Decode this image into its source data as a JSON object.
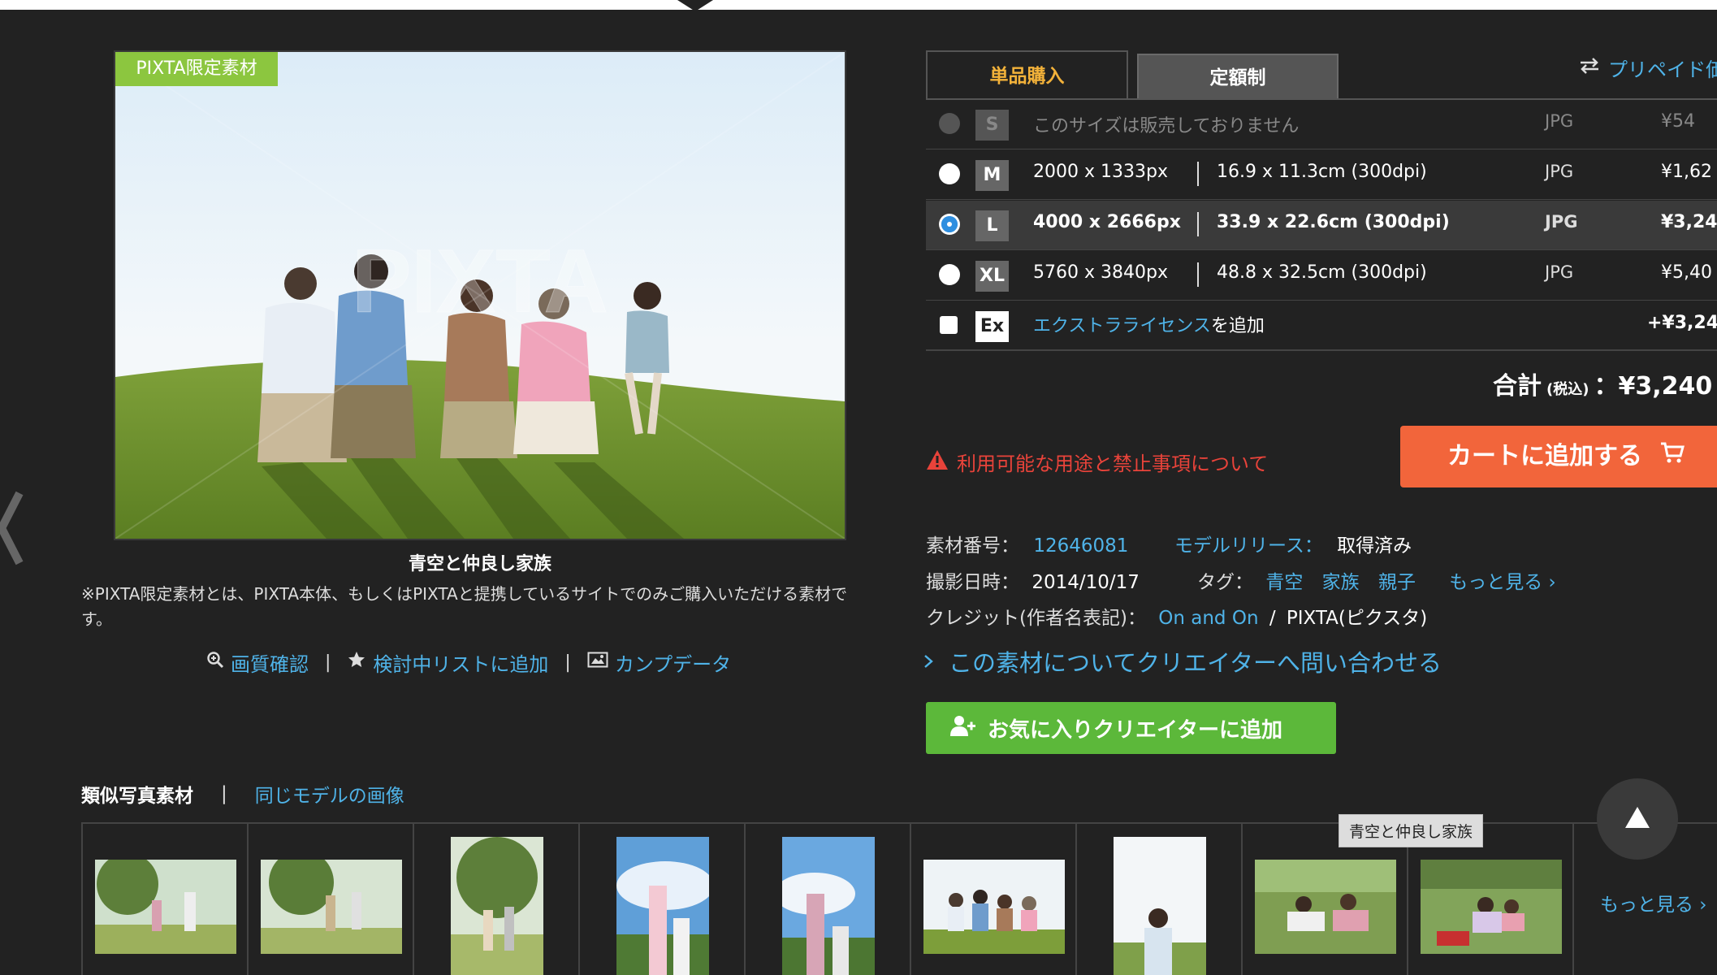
{
  "photo": {
    "exclusive_badge": "PIXTA限定素材",
    "watermark": "PIXTA",
    "title": "青空と仲良し家族",
    "exclusive_note": "※PIXTA限定素材とは、PIXTA本体、もしくはPIXTAと提携しているサイトでのみご購入いただける素材です。",
    "actions": {
      "quality_check": "画質確認",
      "add_to_list": "検討中リストに追加",
      "comp_data": "カンプデータ"
    }
  },
  "purchase": {
    "tabs": {
      "single": "単品購入",
      "subscription": "定額制"
    },
    "prepaid": "プリペイド価",
    "sizes": [
      {
        "code": "S",
        "not_sold": "このサイズは販売しておりません",
        "format": "JPG",
        "price": "¥54",
        "available": false
      },
      {
        "code": "M",
        "pixels": "2000 x 1333px",
        "print": "16.9 x 11.3cm (300dpi)",
        "format": "JPG",
        "price": "¥1,62",
        "available": true
      },
      {
        "code": "L",
        "pixels": "4000 x 2666px",
        "print": "33.9 x 22.6cm (300dpi)",
        "format": "JPG",
        "price": "¥3,24",
        "available": true,
        "selected": true
      },
      {
        "code": "XL",
        "pixels": "5760 x 3840px",
        "print": "48.8 x 32.5cm (300dpi)",
        "format": "JPG",
        "price": "¥5,40",
        "available": true
      }
    ],
    "extra_license": {
      "code": "Ex",
      "link": "エクストラライセンス",
      "suffix": "を追加",
      "price": "+¥3,24"
    },
    "total": {
      "label": "合計",
      "tax": "(税込)",
      "value": "：¥3,240"
    },
    "usage_warning": "利用可能な用途と禁止事項について",
    "cart_button": "カートに追加する"
  },
  "details": {
    "material_no_label": "素材番号：",
    "material_no": "12646081",
    "model_release_label": "モデルリリース：",
    "model_release": "取得済み",
    "shot_date_label": "撮影日時：",
    "shot_date": "2014/10/17",
    "tags_label": "タグ：",
    "tags": [
      "青空",
      "家族",
      "親子"
    ],
    "more_tags": "もっと見る ›",
    "credit_label": "クレジット(作者名表記)：",
    "credit_author": "On and On",
    "credit_sep": "/",
    "credit_site": "PIXTA(ピクスタ)",
    "inquiry": "この素材についてクリエイターへ問い合わせる",
    "favorite_button": "お気に入りクリエイターに追加"
  },
  "similar": {
    "tab_active": "類似写真素材",
    "tab_other": "同じモデルの画像",
    "more": "もっと見る ›",
    "tooltip": "青空と仲良し家族"
  },
  "colors": {
    "accent_blue": "#4fb3e8",
    "cart_orange": "#f2653b",
    "favorite_green": "#5cb83a",
    "badge_green": "#8cc63f",
    "warning_red": "#e8433a",
    "tab_gold": "#f3b23a"
  }
}
